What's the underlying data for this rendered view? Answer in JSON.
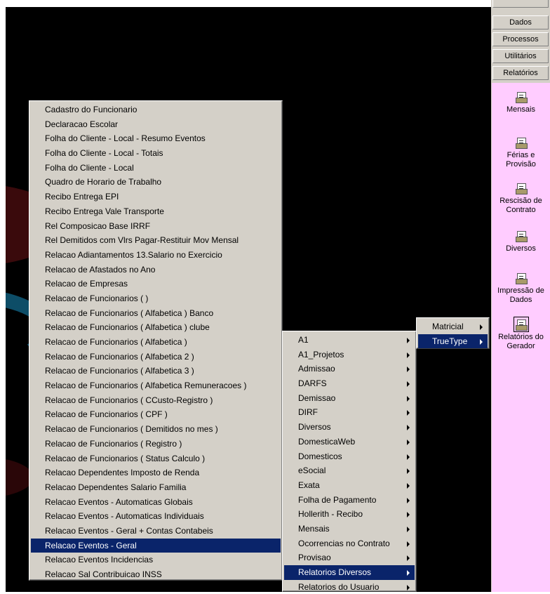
{
  "side_panel": {
    "buttons": [
      "Dados",
      "Processos",
      "Utilitários",
      "Relatórios"
    ],
    "items": [
      {
        "label": "Mensais",
        "icon": "report-print-icon"
      },
      {
        "label": "Férias e Provisão",
        "icon": "report-print-icon"
      },
      {
        "label": "Rescisão de Contrato",
        "icon": "report-print-icon"
      },
      {
        "label": "Diversos",
        "icon": "report-print-icon"
      },
      {
        "label": "Impressão de Dados",
        "icon": "report-print-icon"
      },
      {
        "label": "Relatórios do Gerador",
        "icon": "report-print-icon",
        "selected": true
      }
    ],
    "content_color": "#ffccff"
  },
  "menu_main": {
    "items": [
      "Cadastro do Funcionario",
      "Declaracao Escolar",
      "Folha do Cliente - Local - Resumo Eventos",
      "Folha do Cliente - Local - Totais",
      "Folha do Cliente - Local",
      "Quadro de Horario de Trabalho",
      "Recibo Entrega EPI",
      "Recibo Entrega Vale Transporte",
      "Rel Composicao Base IRRF",
      "Rel Demitidos com Vlrs Pagar-Restituir Mov Mensal",
      "Relacao Adiantamentos 13.Salario no Exercicio",
      "Relacao de Afastados no Ano",
      "Relacao de Empresas",
      "Relacao de Funcionarios (  )",
      "Relacao de Funcionarios ( Alfabetica ) Banco",
      "Relacao de Funcionarios ( Alfabetica ) clube",
      "Relacao de Funcionarios ( Alfabetica )",
      "Relacao de Funcionarios ( Alfabetica 2 )",
      "Relacao de Funcionarios ( Alfabetica 3 )",
      "Relacao de Funcionarios ( Alfabetica Remuneracoes )",
      "Relacao de Funcionarios ( CCusto-Registro )",
      "Relacao de Funcionarios ( CPF )",
      "Relacao de Funcionarios ( Demitidos no mes )",
      "Relacao de Funcionarios ( Registro )",
      "Relacao de Funcionarios ( Status Calculo )",
      "Relacao Dependentes Imposto de Renda",
      "Relacao Dependentes Salario Familia",
      "Relacao Eventos - Automaticas Globais",
      "Relacao Eventos - Automaticas Individuais",
      "Relacao Eventos - Geral + Contas Contabeis",
      "Relacao Eventos - Geral",
      "Relacao Eventos Incidencias",
      "Relacao Sal Contribuicao INSS"
    ],
    "selected": "Relacao Eventos - Geral"
  },
  "menu_categories": {
    "items": [
      "A1",
      "A1_Projetos",
      "Admissao",
      "DARFS",
      "Demissao",
      "DIRF",
      "Diversos",
      "DomesticaWeb",
      "Domesticos",
      "eSocial",
      "Exata",
      "Folha de Pagamento",
      "Hollerith - Recibo",
      "Mensais",
      "Ocorrencias no Contrato",
      "Provisao",
      "Relatorios Diversos",
      "Relatorios do Usuario"
    ],
    "selected": "Relatorios Diversos"
  },
  "menu_type": {
    "items": [
      "Matricial",
      "TrueType"
    ],
    "selected": "TrueType"
  },
  "colors": {
    "menu_bg": "#d4d0c8",
    "highlight": "#0a246a",
    "desktop": "#000000"
  }
}
